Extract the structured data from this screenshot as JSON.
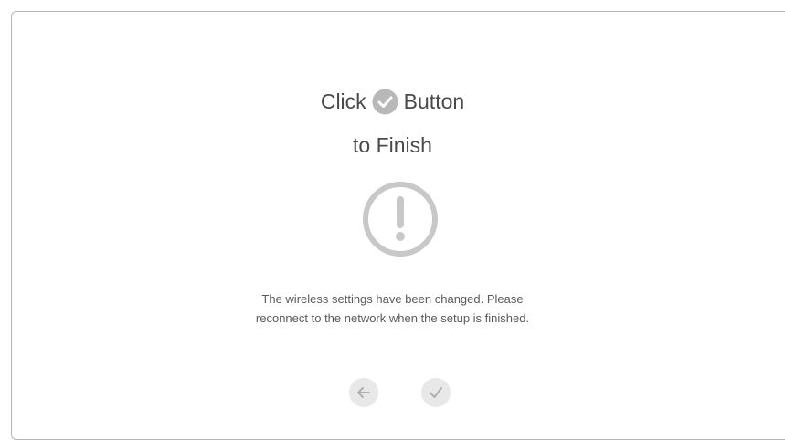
{
  "heading": {
    "line1_before": "Click",
    "line1_after": "Button",
    "line2": "to Finish"
  },
  "icons": {
    "inline_check": "check-circle-icon",
    "alert": "exclamation-circle-icon",
    "back": "arrow-left-icon",
    "finish": "check-icon"
  },
  "message": {
    "line1": "The wireless settings have been changed. Please",
    "line2": "reconnect to the network when the setup is finished."
  },
  "colors": {
    "text": "#4a4a4a",
    "icon_gray": "#c8c8c8",
    "button_bg": "#e8e8e8",
    "border": "#b5b5b5"
  }
}
